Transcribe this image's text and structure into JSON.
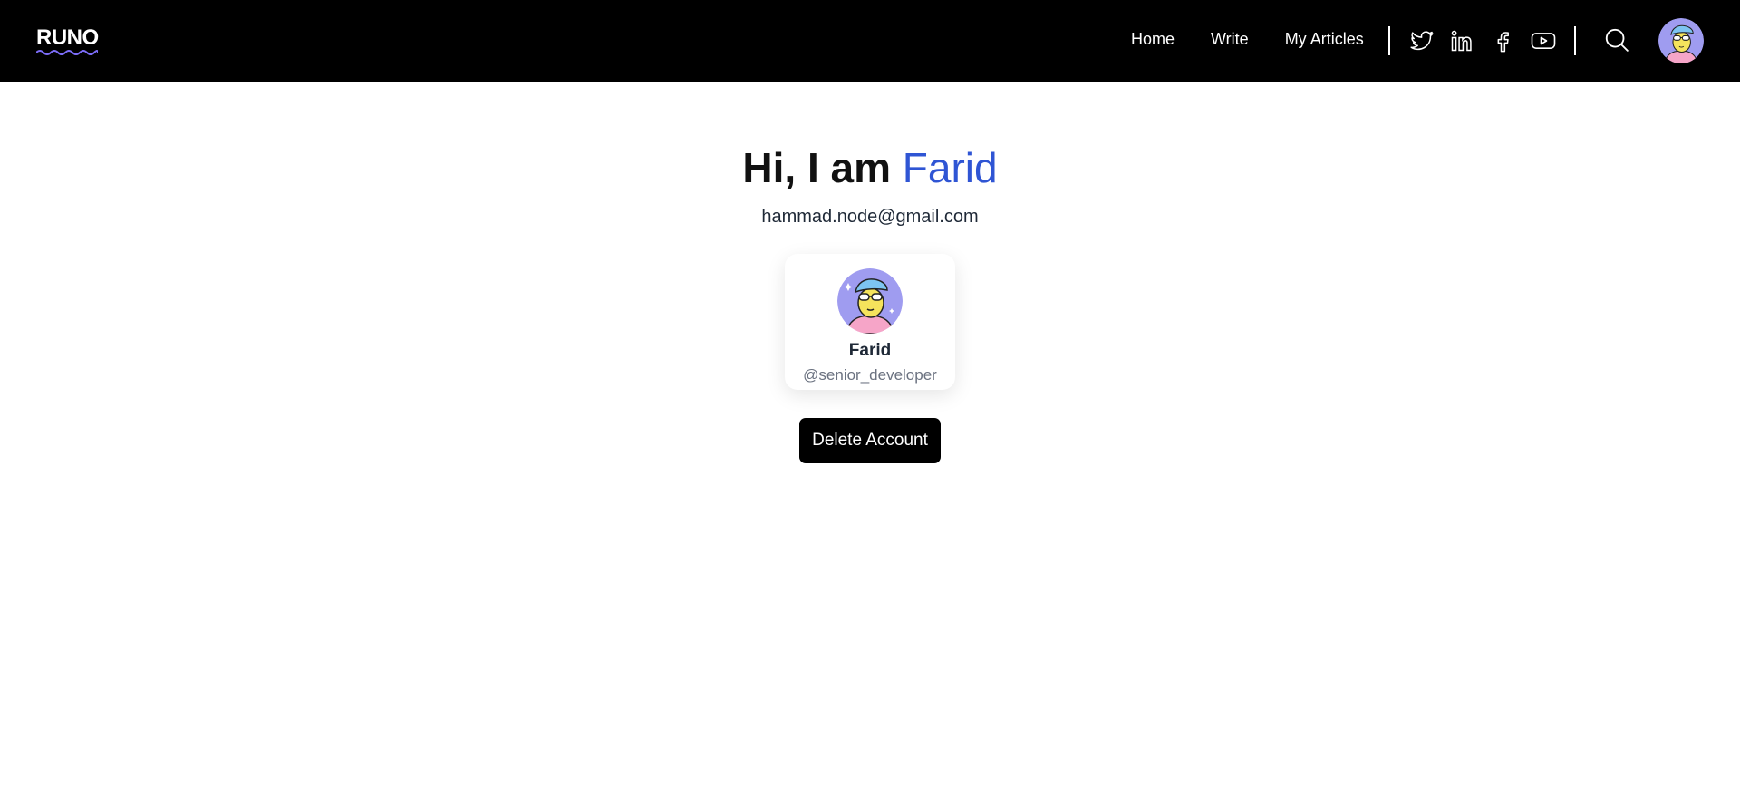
{
  "nav": {
    "logo": "RUNO",
    "links": [
      {
        "label": "Home"
      },
      {
        "label": "Write"
      },
      {
        "label": "My Articles"
      }
    ],
    "social_icons": [
      "twitter-icon",
      "linkedin-icon",
      "facebook-icon",
      "youtube-icon"
    ],
    "search_icon": "search-icon"
  },
  "profile": {
    "greeting": "Hi, I am ",
    "name": "Farid",
    "email": "hammad.node@gmail.com",
    "card": {
      "name": "Farid",
      "handle": "@senior_developer"
    },
    "delete_label": "Delete Account"
  },
  "colors": {
    "nav_bg": "#000000",
    "accent": "#2f55d4",
    "logo_underline": "#7b6cf6",
    "avatar_bg": "#9f9cf0"
  }
}
